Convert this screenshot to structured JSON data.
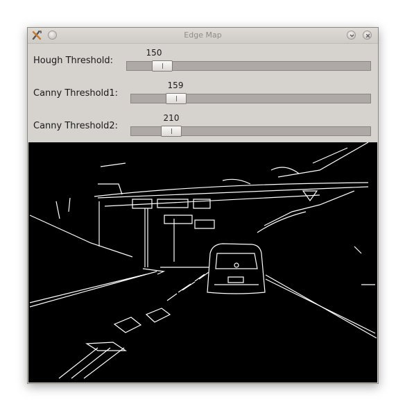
{
  "window": {
    "title": "Edge Map"
  },
  "controls": {
    "hough": {
      "label": "Hough Threshold:",
      "value": "150",
      "fraction": 0.113
    },
    "canny1": {
      "label": "Canny Threshold1:",
      "value": "159",
      "fraction": 0.158
    },
    "canny2": {
      "label": "Canny Threshold2:",
      "value": "210",
      "fraction": 0.136
    }
  },
  "icons": {
    "app": "tools-icon",
    "menu": "circle-icon",
    "minimize": "chevron-down-icon",
    "close": "close-icon"
  },
  "colors": {
    "window_bg": "#d6d2ce",
    "trough": "#aea9a6",
    "edge_bg": "#000000",
    "edge_lines": "#ffffff"
  }
}
